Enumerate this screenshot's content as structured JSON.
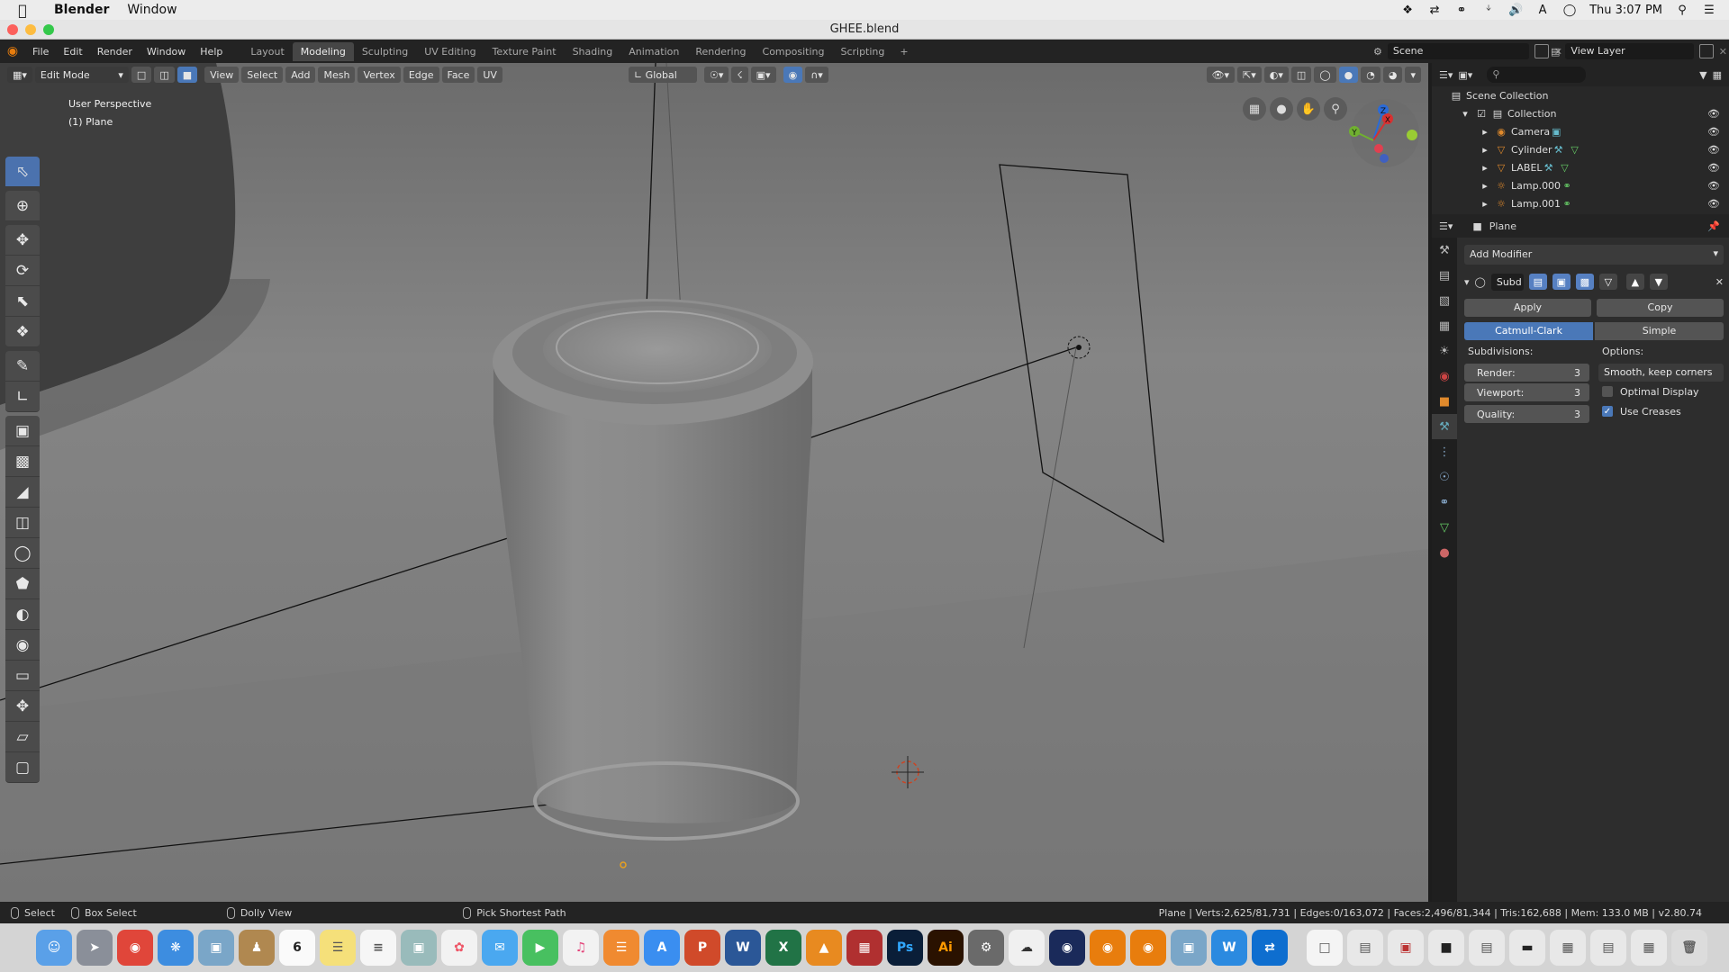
{
  "macbar": {
    "app_name": "Blender",
    "menus": [
      "Window"
    ],
    "clock": "Thu 3:07 PM"
  },
  "window": {
    "title": "GHEE.blend"
  },
  "topbar": {
    "menus": [
      "File",
      "Edit",
      "Render",
      "Window",
      "Help"
    ],
    "workspaces": [
      "Layout",
      "Modeling",
      "Sculpting",
      "UV Editing",
      "Texture Paint",
      "Shading",
      "Animation",
      "Rendering",
      "Compositing",
      "Scripting"
    ],
    "active_workspace": "Modeling",
    "add_tab": "+",
    "scene": "Scene",
    "view_layer": "View Layer"
  },
  "viewport": {
    "mode": "Edit Mode",
    "menus": [
      "View",
      "Select",
      "Add",
      "Mesh",
      "Vertex",
      "Edge",
      "Face",
      "UV"
    ],
    "orientation": "Global",
    "info_line1": "User Perspective",
    "info_line2": "(1) Plane",
    "gizmo_axes": [
      "Z",
      "X",
      "Y"
    ],
    "colors": {
      "background": "#6f6f6f",
      "accent": "#4a78b8"
    }
  },
  "toolbar": {
    "tools": [
      "select-box",
      "cursor",
      "move",
      "rotate",
      "scale",
      "transform",
      "annotate",
      "measure",
      "extrude",
      "inset",
      "bevel",
      "loop-cut",
      "knife",
      "poly-build",
      "spin",
      "smooth",
      "edge-slide",
      "shrink-fatten",
      "shear",
      "rip"
    ]
  },
  "outliner": {
    "root": "Scene Collection",
    "collection": "Collection",
    "items": [
      {
        "name": "Camera",
        "icon": "camera-icon"
      },
      {
        "name": "Cylinder",
        "icon": "mesh-icon"
      },
      {
        "name": "LABEL",
        "icon": "mesh-icon"
      },
      {
        "name": "Lamp.000",
        "icon": "lamp-icon"
      },
      {
        "name": "Lamp.001",
        "icon": "lamp-icon"
      }
    ]
  },
  "properties": {
    "object_name": "Plane",
    "add_modifier": "Add Modifier",
    "modifier_name": "Subd",
    "apply": "Apply",
    "copy": "Copy",
    "algorithms": [
      "Catmull-Clark",
      "Simple"
    ],
    "active_algorithm": "Catmull-Clark",
    "subdivisions_label": "Subdivisions:",
    "options_label": "Options:",
    "render_label": "Render:",
    "render_value": "3",
    "viewport_label": "Viewport:",
    "viewport_value": "3",
    "quality_label": "Quality:",
    "quality_value": "3",
    "uv_smooth": "Smooth, keep corners",
    "optimal_display": {
      "label": "Optimal Display",
      "checked": false
    },
    "use_creases": {
      "label": "Use Creases",
      "checked": true
    }
  },
  "statusbar": {
    "select": "Select",
    "box_select": "Box Select",
    "dolly": "Dolly View",
    "pick_path": "Pick Shortest Path",
    "info": "Plane | Verts:2,625/81,731 | Edges:0/163,072 | Faces:2,496/81,344 | Tris:162,688 | Mem: 133.0 MB | v2.80.74"
  },
  "dock": {
    "apps": [
      "Finder",
      "Launchpad",
      "Chrome",
      "Safari",
      "Preview",
      "Contacts",
      "Calendar",
      "Notes",
      "Reminders",
      "Photo Booth",
      "Photos",
      "Messages",
      "FaceTime",
      "iTunes",
      "iBooks",
      "App Store",
      "PowerPoint",
      "Word",
      "Excel",
      "VLC",
      "Toolbox",
      "Ps",
      "Ai",
      "System Preferences",
      "Sheep",
      "Cinema 4D",
      "Blender",
      "Blender 2.8",
      "Preview 2",
      "Wunderlist",
      "TeamViewer"
    ],
    "calendar_day": "6",
    "ps_label": "Ps",
    "ai_label": "Ai",
    "word_label": "W",
    "excel_label": "X"
  }
}
